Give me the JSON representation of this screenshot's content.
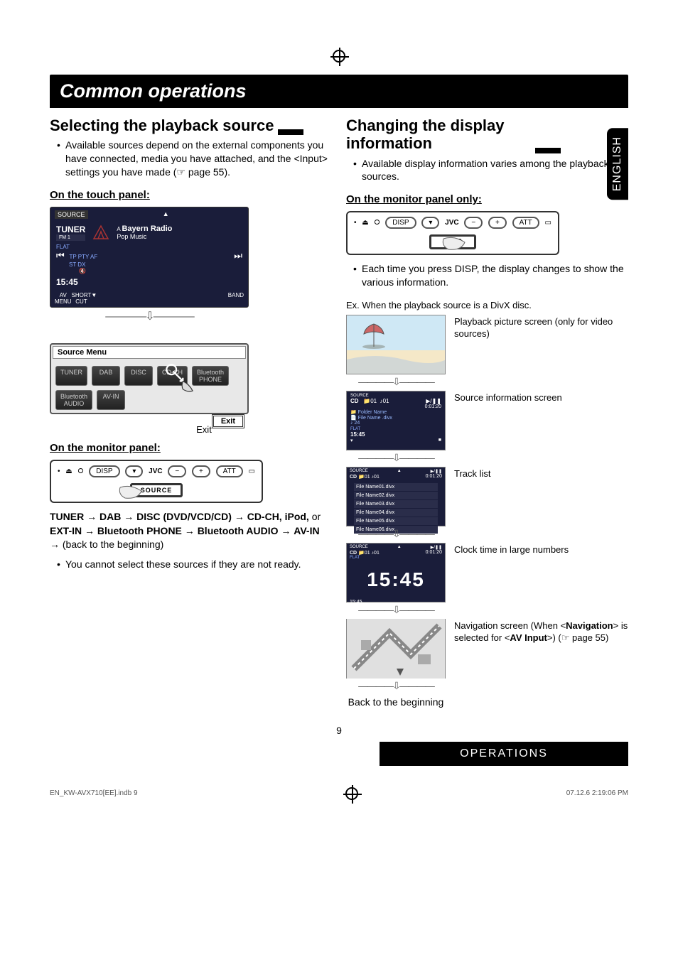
{
  "crop_center": "⊕",
  "title": "Common operations",
  "lang_tab": "ENGLISH",
  "left": {
    "heading": "Selecting the playback source",
    "bullet": "Available sources depend on the external components you have connected, media you have attached, and the <Input> settings you have made (☞ page 55).",
    "sub_touch": "On the touch panel:",
    "tuner_screen": {
      "source_label": "SOURCE",
      "tuner": "TUNER",
      "band_small": "FM 1",
      "station": "Bayern Radio",
      "subtitle": "Pop Music",
      "flat": "FLAT",
      "flags": "TP PTY AF",
      "stdx": "ST  DX",
      "time": "15:45",
      "av_menu": "AV\nMENU",
      "short": "SHORT\nCUT",
      "band": "BAND",
      "prev": "⏮",
      "up": "▲",
      "down": "▼",
      "next": "⏭"
    },
    "source_menu": {
      "title": "Source Menu",
      "items": [
        "TUNER",
        "DAB",
        "DISC",
        "CD-CH",
        "Bluetooth\nPHONE",
        "Bluetooth\nAUDIO",
        "AV-IN"
      ],
      "exit_btn": "Exit",
      "exit_label": "Exit"
    },
    "sub_monitor": "On the monitor panel:",
    "monitor_panel": {
      "jvc": "JVC",
      "source_btn": "SOURCE",
      "disp_btn": "DISP",
      "minus": "−",
      "plus": "+"
    },
    "sequence_parts": {
      "p1": "TUNER",
      "p2": "DAB",
      "p3": "DISC (DVD/VCD/CD)",
      "p4": "CD-CH, iPod,",
      "or": " or ",
      "p5": "EXT-IN",
      "p6": "Bluetooth PHONE",
      "p7": "Bluetooth AUDIO",
      "p8": "AV-IN",
      "tail": "(back to the beginning)"
    },
    "note": "You cannot select these sources if they are not ready."
  },
  "right": {
    "heading": "Changing the display information",
    "bullet": "Available display information varies among the playback sources.",
    "sub_monitor": "On the monitor panel only:",
    "disp_note": "Each time you press DISP, the display changes to show the various information.",
    "ex_label": "Ex. When the playback source is a DivX disc.",
    "thumbs": {
      "t1": "Playback picture screen (only for video sources)",
      "t2": "Source information screen",
      "t3": "Track list",
      "t4": "Clock time in large numbers",
      "t5a": "Navigation screen (When <",
      "t5b": "Navigation",
      "t5c": "> is selected for <",
      "t5d": "AV Input",
      "t5e": ">) (☞ page 55)"
    },
    "source_info": {
      "source": "SOURCE",
      "cd": "CD",
      "track": "01",
      "folder_no": "01",
      "time": "0:01:20",
      "folder": "Folder Name",
      "file": "File Name .divx",
      "num": "24",
      "flat": "FLAT",
      "clock": "15:45",
      "play": "▶/❚❚",
      "stop": "■"
    },
    "track_list_items": [
      "File Name01.divx",
      "File Name02.divx",
      "File Name03.divx",
      "File Name04.divx",
      "File Name05.divx",
      "File Name06.divx"
    ],
    "big_clock": "15:45",
    "back": "Back to the beginning"
  },
  "page_num": "9",
  "ops_band": "OPERATIONS",
  "footer": {
    "left": "EN_KW-AVX710[EE].indb   9",
    "right": "07.12.6   2:19:06 PM"
  }
}
